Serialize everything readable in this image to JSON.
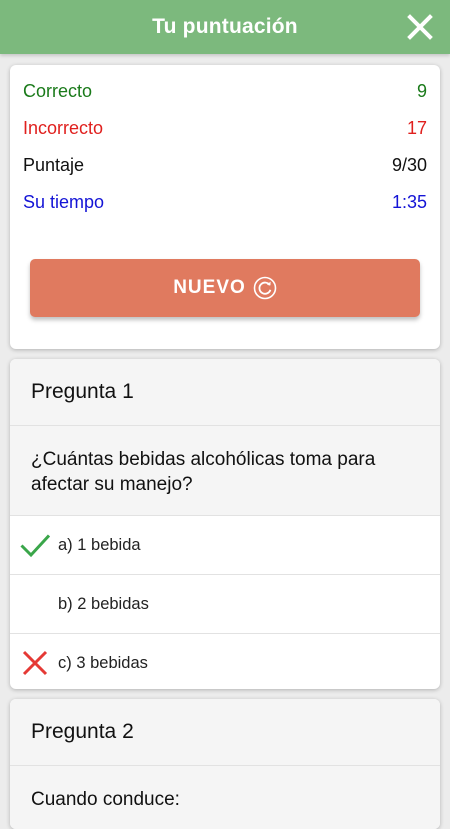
{
  "header": {
    "title": "Tu puntuación"
  },
  "stats": {
    "correct_label": "Correcto",
    "correct_value": "9",
    "incorrect_label": "Incorrecto",
    "incorrect_value": "17",
    "score_label": "Puntaje",
    "score_value": "9/30",
    "time_label": "Su tiempo",
    "time_value": "1:35"
  },
  "new_button": {
    "label": "NUEVO"
  },
  "questions": [
    {
      "title": "Pregunta 1",
      "text": "¿Cuántas bebidas alcohólicas toma para afectar su manejo?",
      "answers": [
        {
          "label": "a) 1 bebida",
          "mark": "check-icon"
        },
        {
          "label": "b) 2 bebidas",
          "mark": ""
        },
        {
          "label": "c) 3 bebidas",
          "mark": "x-icon"
        }
      ]
    },
    {
      "title": "Pregunta 2",
      "text": "Cuando conduce:"
    }
  ],
  "colors": {
    "header": "#7cb97d",
    "correct": "#1a7a1a",
    "incorrect": "#e0201e",
    "time": "#1414d6",
    "button": "#e07a5f",
    "check": "#3aa64a",
    "cross": "#e53935"
  }
}
